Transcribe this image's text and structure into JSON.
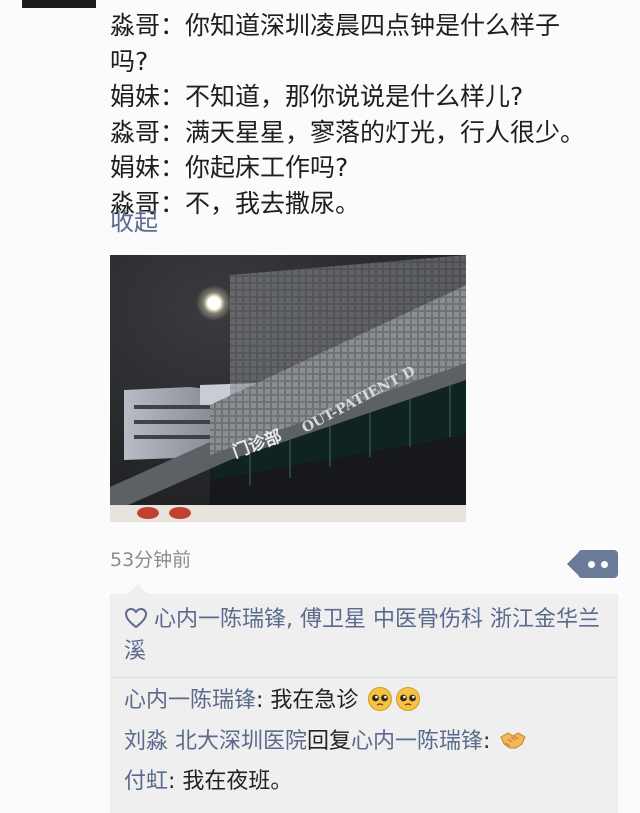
{
  "post": {
    "lines": [
      "",
      "淼哥：你知道深圳凌晨四点钟是什么样子",
      "吗?",
      "娟妹：不知道，那你说说是什么样儿?",
      "淼哥：满天星星，寥落的灯光，行人很少。",
      "娟妹：你起床工作吗?",
      "淼哥：不，我去撒尿。"
    ],
    "collapse_label": "收起",
    "photo_sign_chinese": "门诊部",
    "photo_sign_english": "OUT-PATIENT D",
    "timestamp": "53分钟前"
  },
  "likes": {
    "names": "心内一陈瑞锋, 傅卫星 中医骨伤科 浙江金华兰溪"
  },
  "comments": [
    {
      "author": "心内一陈瑞锋",
      "separator": ": ",
      "text": "我在急诊",
      "emoji": [
        "pleading-face",
        "pleading-face"
      ]
    },
    {
      "author": "刘淼 北大深圳医院",
      "reply_word": "回复",
      "reply_to": "心内一陈瑞锋",
      "separator": ": ",
      "emoji": [
        "handshake"
      ]
    },
    {
      "author": "付虹",
      "separator": ": ",
      "text": "我在夜班。"
    }
  ],
  "colors": {
    "link": "#5b6b8c",
    "comment_bg": "#efefef",
    "more_button": "#6b7a99"
  }
}
